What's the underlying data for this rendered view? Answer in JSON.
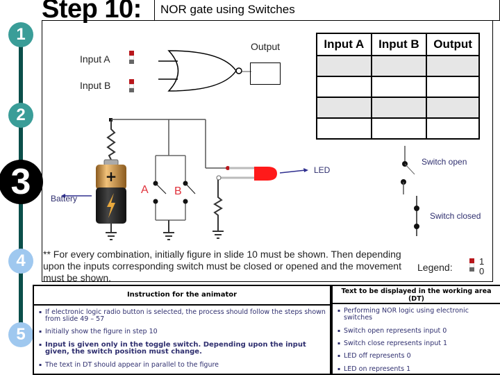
{
  "header": {
    "step_title": "Step 10:",
    "subtitle": "NOR  gate using Switches"
  },
  "timeline": {
    "steps": [
      {
        "label": "1",
        "state": "done",
        "color": "#3a9d98"
      },
      {
        "label": "2",
        "state": "done",
        "color": "#3a9d98"
      },
      {
        "label": "3",
        "state": "current",
        "color": "#000000"
      },
      {
        "label": "4",
        "state": "upcoming",
        "color": "#9fc8ef"
      },
      {
        "label": "5",
        "state": "upcoming",
        "color": "#9fc8ef"
      }
    ],
    "line_color": "#0b4f4a"
  },
  "gate_diagram": {
    "input_a_label": "Input A",
    "input_b_label": "Input B",
    "output_label": "Output",
    "gate_type": "NOR"
  },
  "truth_table": {
    "headers": [
      "Input A",
      "Input B",
      "Output"
    ],
    "rows": [
      [
        "",
        "",
        ""
      ],
      [
        "",
        "",
        ""
      ],
      [
        "",
        "",
        ""
      ],
      [
        "",
        "",
        ""
      ]
    ]
  },
  "circuit": {
    "battery_label": "Battery",
    "switch_a_label": "A",
    "switch_b_label": "B",
    "led_label": "LED",
    "switch_open_label": "Switch open",
    "switch_closed_label": "Switch closed",
    "switch_label_color": "#e0303a",
    "led_color": "#ff1a1a"
  },
  "note": "** For every combination, initially figure in slide 10 must be shown. Then depending upon the inputs corresponding switch must be closed or opened and the movement must be shown.",
  "legend": {
    "label": "Legend:",
    "on_value": "1",
    "off_value": "0",
    "on_color": "#b8161b",
    "off_color": "#666666"
  },
  "instructions": {
    "title": "Instruction for the animator",
    "items": [
      "If electronic logic radio button is selected, the process should follow  the steps shown from slide 49 – 57",
      "Initially show  the figure in step 10",
      "Input is given only in the toggle switch. Depending upon the input given, the switch position must change.",
      "The text in DT should appear  in parallel to the figure"
    ]
  },
  "display_text": {
    "title": "Text to be displayed in the working area (DT)",
    "items": [
      "Performing NOR logic using electronic switches",
      "Switch open represents input 0",
      "Switch close represents input 1",
      "LED off represents 0",
      "LED on represents 1"
    ]
  }
}
